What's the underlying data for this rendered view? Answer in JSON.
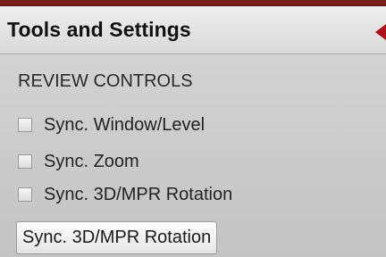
{
  "panel": {
    "title": "Tools and Settings",
    "collapse_icon": "collapse-left-arrow-icon"
  },
  "review_controls": {
    "heading": "REVIEW CONTROLS",
    "options": [
      {
        "label": "Sync. Window/Level",
        "checked": false
      },
      {
        "label": "Sync. Zoom",
        "checked": false
      },
      {
        "label": "Sync. 3D/MPR Rotation",
        "checked": false
      }
    ],
    "button_label": "Sync. 3D/MPR Rotation"
  },
  "colors": {
    "accent": "#b0101a",
    "top_edge": "#7a1f1f"
  }
}
